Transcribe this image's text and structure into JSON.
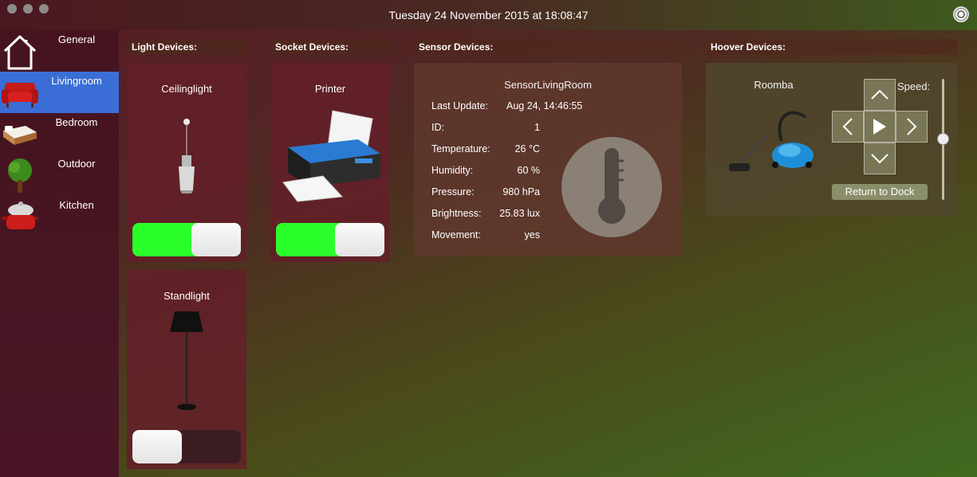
{
  "window": {
    "datetime": "Tuesday 24 November 2015 at 18:08:47"
  },
  "sidebar": {
    "items": [
      {
        "label": "General",
        "icon": "house-icon"
      },
      {
        "label": "Livingroom",
        "icon": "sofa-icon",
        "active": true
      },
      {
        "label": "Bedroom",
        "icon": "bed-icon"
      },
      {
        "label": "Outdoor",
        "icon": "tree-icon"
      },
      {
        "label": "Kitchen",
        "icon": "cooking-pot-icon"
      }
    ]
  },
  "sections": {
    "light": "Light Devices:",
    "socket": "Socket Devices:",
    "sensor": "Sensor Devices:",
    "hoover": "Hoover Devices:"
  },
  "lights": [
    {
      "name": "Ceilinglight",
      "on": true
    },
    {
      "name": "Standlight",
      "on": false
    }
  ],
  "sockets": [
    {
      "name": "Printer",
      "on": true
    }
  ],
  "sensor": {
    "name": "SensorLivingRoom",
    "rows": [
      {
        "label": "Last Update:",
        "value": "Aug 24, 14:46:55"
      },
      {
        "label": "ID:",
        "value": "1"
      },
      {
        "label": "Temperature:",
        "value": "26 °C"
      },
      {
        "label": "Humidity:",
        "value": "60 %"
      },
      {
        "label": "Pressure:",
        "value": "980 hPa"
      },
      {
        "label": "Brightness:",
        "value": "25.83 lux"
      },
      {
        "label": "Movement:",
        "value": "yes"
      }
    ]
  },
  "hoover": {
    "name": "Roomba",
    "speed_label": "Speed:",
    "dock_label": "Return to Dock",
    "speed_level": 0.5
  },
  "colors": {
    "toggle_on": "#2bff2b",
    "active_item": "#3a6ed6"
  }
}
